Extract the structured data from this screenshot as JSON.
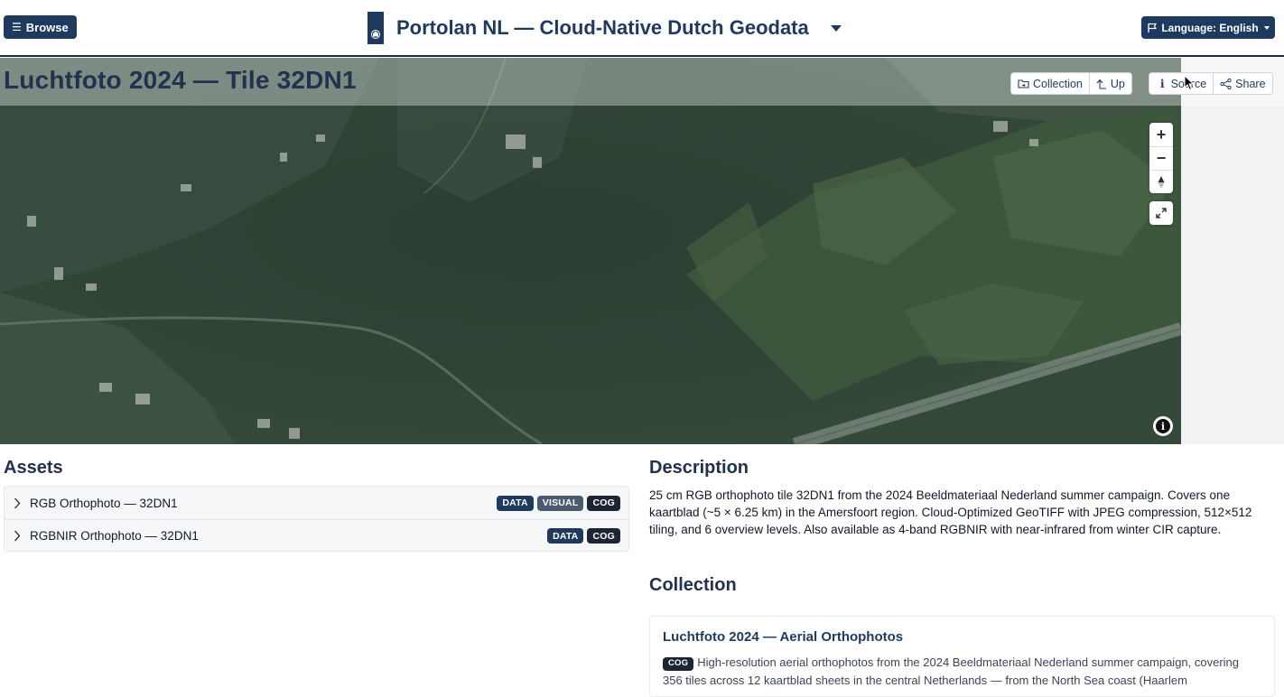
{
  "header": {
    "browse_label": "Browse",
    "app_title": "Portolan NL — Cloud-Native Dutch Geodata",
    "language_label": "Language: English"
  },
  "page": {
    "title": "Luchtfoto 2024 — Tile 32DN1",
    "actions": {
      "collection": "Collection",
      "up": "Up",
      "source": "Source",
      "share": "Share"
    }
  },
  "map": {
    "controls": [
      "zoom-in",
      "zoom-out",
      "reset-north",
      "fullscreen",
      "attribution-info"
    ]
  },
  "assets": {
    "heading": "Assets",
    "items": [
      {
        "label": "RGB Orthophoto — 32DN1",
        "badges": [
          "DATA",
          "VISUAL",
          "COG"
        ]
      },
      {
        "label": "RGBNIR Orthophoto — 32DN1",
        "badges": [
          "DATA",
          "COG"
        ]
      }
    ]
  },
  "description": {
    "heading": "Description",
    "text": "25 cm RGB orthophoto tile 32DN1 from the 2024 Beeldmateriaal Nederland summer campaign. Covers one kaartblad (~5 × 6.25 km) in the Amersfoort region. Cloud-Optimized GeoTIFF with JPEG compression, 512×512 tiling, and 6 overview levels. Also available as 4-band RGBNIR with near-infrared from winter CIR capture."
  },
  "collection": {
    "heading": "Collection",
    "title": "Luchtfoto 2024 — Aerial Orthophotos",
    "badge": "COG",
    "text": "High-resolution aerial orthophotos from the 2024 Beeldmateriaal Nederland summer campaign, covering 356 tiles across 12 kaartblad sheets in the central Netherlands — from the North Sea coast (Haarlem"
  },
  "colors": {
    "brand": "#1e3a5f",
    "badge_data": "#1e3a5f",
    "badge_visual": "#4b5a6e",
    "badge_cog": "#1d2433"
  }
}
